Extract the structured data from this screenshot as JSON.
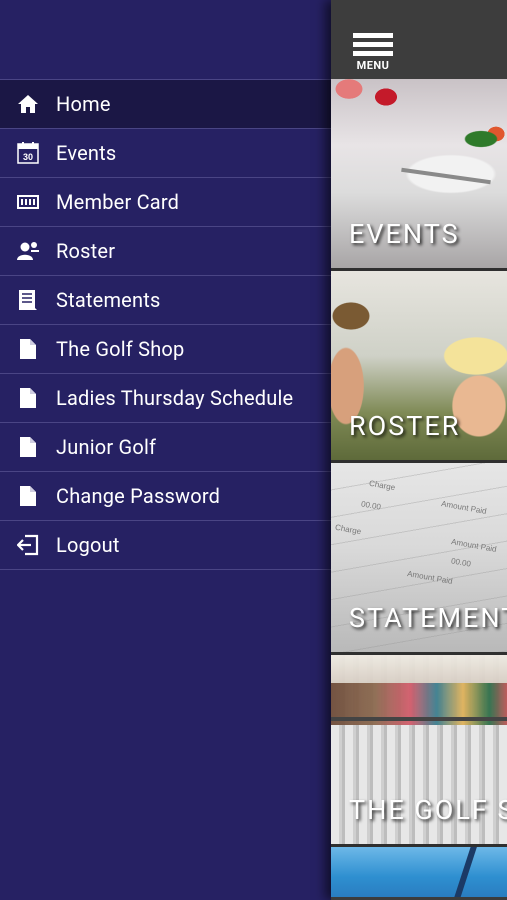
{
  "menu_button_label": "MENU",
  "drawer": {
    "items": [
      {
        "label": "Home",
        "icon": "home-icon",
        "active": true
      },
      {
        "label": "Events",
        "icon": "calendar-icon",
        "badge": "30"
      },
      {
        "label": "Member Card",
        "icon": "member-card-icon"
      },
      {
        "label": "Roster",
        "icon": "roster-icon"
      },
      {
        "label": "Statements",
        "icon": "statements-icon"
      },
      {
        "label": "The Golf Shop",
        "icon": "page-icon"
      },
      {
        "label": "Ladies Thursday Schedule",
        "icon": "page-icon"
      },
      {
        "label": "Junior Golf",
        "icon": "page-icon"
      },
      {
        "label": "Change Password",
        "icon": "page-icon"
      },
      {
        "label": "Logout",
        "icon": "logout-icon"
      }
    ]
  },
  "tiles": [
    {
      "caption": "EVENTS"
    },
    {
      "caption": "ROSTER"
    },
    {
      "caption": "STATEMENTS"
    },
    {
      "caption": "THE GOLF SHOP"
    }
  ],
  "statement_notes": [
    "Charge",
    "Amount Paid",
    "00.00",
    "Charge",
    "Amount Paid",
    "00.00",
    "Amount Paid"
  ],
  "colors": {
    "drawer_bg": "#262163",
    "active_item_bg": "#1b1745",
    "divider": "#4a4585",
    "topbar_bg": "#3d3d3d"
  }
}
